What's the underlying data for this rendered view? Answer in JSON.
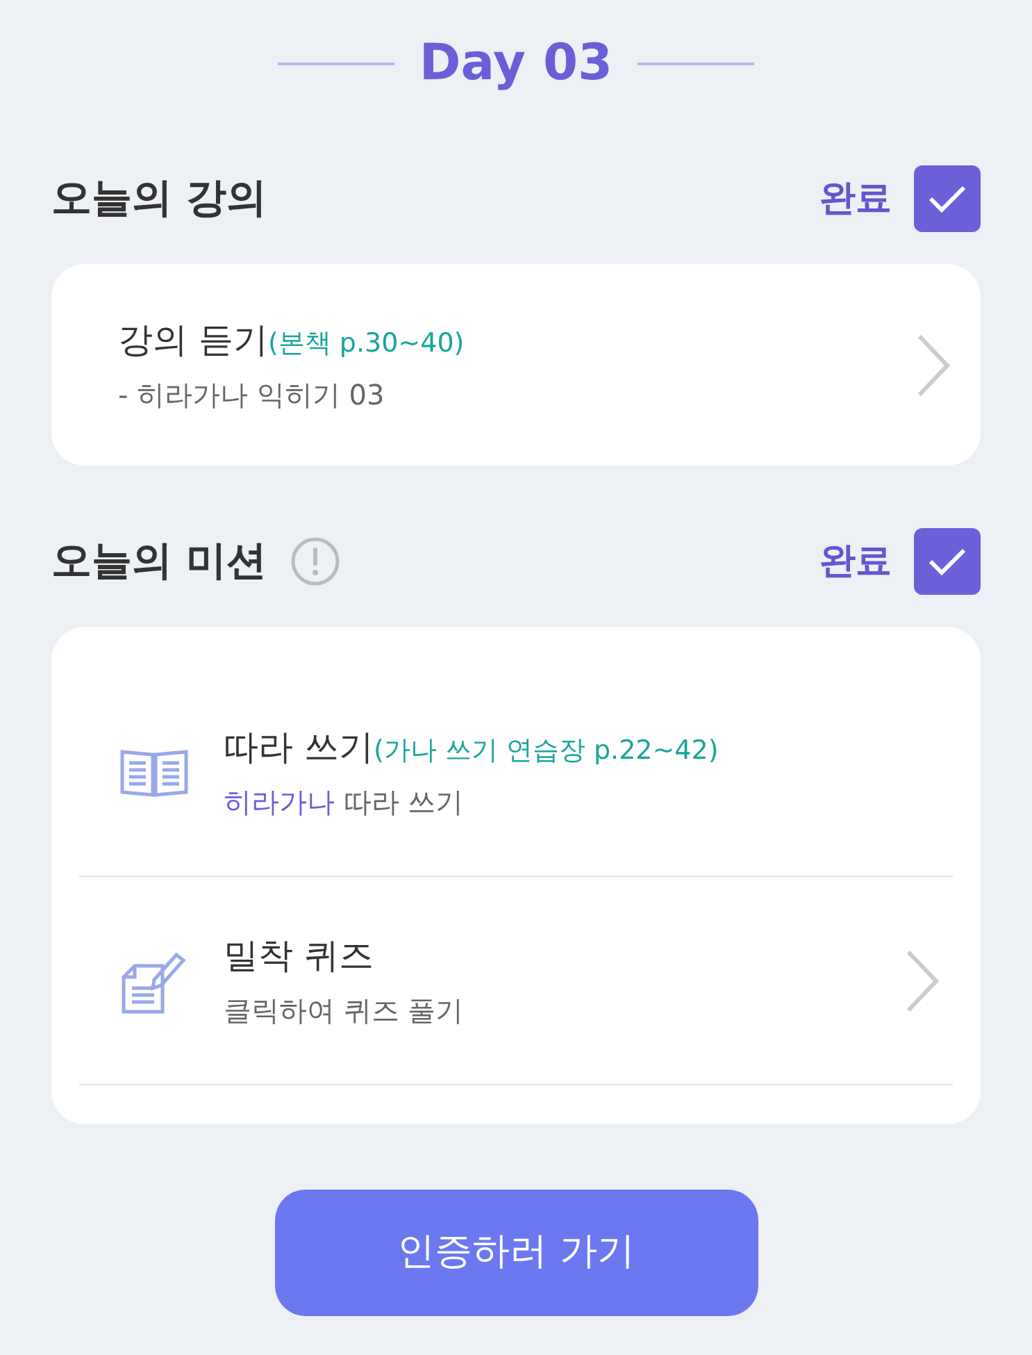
{
  "day_title": "Day 03",
  "sections": [
    {
      "title": "오늘의 강의",
      "info_icon": false,
      "status": "완료",
      "checked": true,
      "items": [
        {
          "kind": "lecture",
          "title": "강의 듣기",
          "ref": "(본책 p.30~40)",
          "subtitle": "- 히라가나 익히기 03",
          "chevron": true
        }
      ]
    },
    {
      "title": "오늘의 미션",
      "info_icon": true,
      "status": "완료",
      "checked": true,
      "items": [
        {
          "kind": "book",
          "title": "따라 쓰기",
          "ref": "(가나 쓰기 연습장 p.22~42)",
          "highlight": "히라가나",
          "subtitle": "따라 쓰기",
          "chevron": false
        },
        {
          "kind": "quiz",
          "title": "밀착 퀴즈",
          "subtitle": "클릭하여 퀴즈 풀기",
          "chevron": true
        }
      ]
    }
  ],
  "button": "인증하러 가기"
}
